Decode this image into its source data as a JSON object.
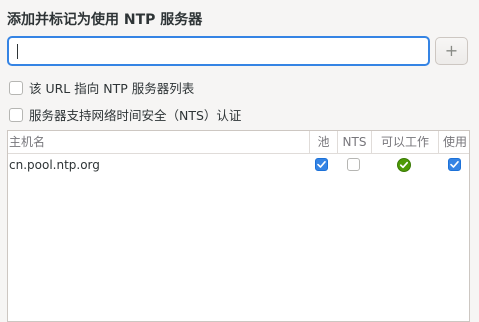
{
  "dialog": {
    "title": "添加并标记为使用 NTP 服务器"
  },
  "server_input": {
    "value": "",
    "placeholder": ""
  },
  "add_button": {
    "label": "+"
  },
  "options": {
    "url_is_list": {
      "label": "该 URL 指向 NTP 服务器列表",
      "checked": false
    },
    "supports_nts": {
      "label": "服务器支持网络时间安全（NTS）认证",
      "checked": false
    }
  },
  "table": {
    "headers": {
      "host": "主机名",
      "pool": "池",
      "nts": "NTS",
      "works": "可以工作",
      "use": "使用"
    },
    "rows": [
      {
        "host": "cn.pool.ntp.org",
        "pool": true,
        "nts": false,
        "works": true,
        "use": true
      }
    ]
  },
  "colors": {
    "accent": "#3584e4",
    "ok_green": "#4e9a06"
  },
  "icons": {
    "works_status": "check-circle-icon",
    "checkbox_checked": "checkmark-icon"
  }
}
